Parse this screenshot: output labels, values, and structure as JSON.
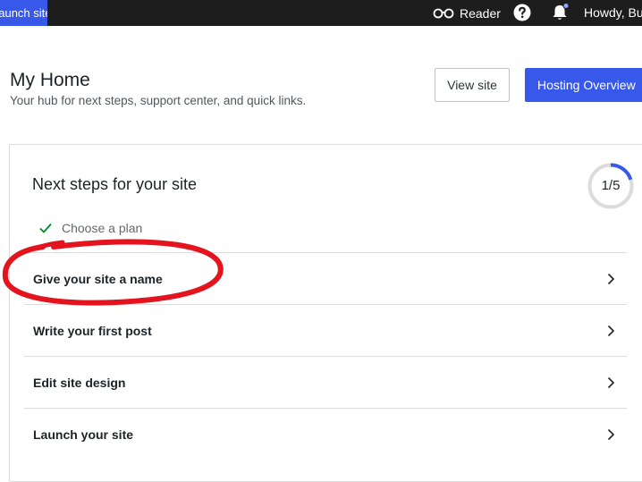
{
  "topbar": {
    "launch_label": "Launch site",
    "reader_label": "Reader",
    "howdy_label": "Howdy, Buck",
    "icons": {
      "reader": "glasses-icon",
      "help": "help-circle-icon",
      "notifications": "bell-icon"
    }
  },
  "header": {
    "title": "My Home",
    "subtitle": "Your hub for next steps, support center, and quick links.",
    "view_site_label": "View site",
    "hosting_label": "Hosting Overview"
  },
  "next_steps": {
    "title": "Next steps for your site",
    "progress": {
      "completed": 1,
      "total": 5,
      "text": "1/5"
    },
    "completed_items": [
      {
        "label": "Choose a plan"
      }
    ],
    "tasks": [
      {
        "label": "Give your site a name"
      },
      {
        "label": "Write your first post"
      },
      {
        "label": "Edit site design"
      },
      {
        "label": "Launch your site"
      }
    ]
  },
  "colors": {
    "accent": "#3858e9",
    "topbar_bg": "#1d1d1d",
    "check_green": "#008a20",
    "annotation_red": "#e3141e"
  }
}
